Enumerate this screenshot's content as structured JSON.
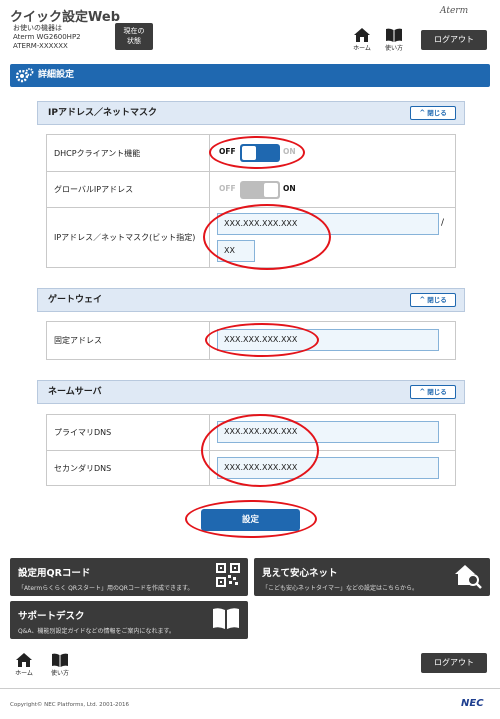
{
  "header": {
    "title": "クイック設定Web",
    "device_line1": "お使いの機器は",
    "device_line2": "Aterm WG2600HP2",
    "device_line3": "ATERM-XXXXXX",
    "status_line1": "現在の",
    "status_line2": "状態",
    "brand": "Aterm",
    "home_label": "ホーム",
    "manual_label": "使い方",
    "logout_label": "ログアウト"
  },
  "section": {
    "title": "詳細設定"
  },
  "panels": {
    "ip": {
      "title": "IPアドレス／ネットマスク",
      "close_label": "閉じる",
      "rows": {
        "dhcp": {
          "label": "DHCPクライアント機能",
          "off": "OFF",
          "on": "ON"
        },
        "global_ip": {
          "label": "グローバルIPアドレス",
          "off": "OFF",
          "on": "ON"
        },
        "ip_mask": {
          "label": "IPアドレス／ネットマスク(ビット指定)",
          "ip_value": "XXX.XXX.XXX.XXX",
          "slash": "/",
          "mask_value": "XX"
        }
      }
    },
    "gateway": {
      "title": "ゲートウェイ",
      "close_label": "閉じる",
      "fixed_label": "固定アドレス",
      "fixed_value": "XXX.XXX.XXX.XXX"
    },
    "dns": {
      "title": "ネームサーバ",
      "close_label": "閉じる",
      "primary_label": "プライマリDNS",
      "primary_value": "XXX.XXX.XXX.XXX",
      "secondary_label": "セカンダリDNS",
      "secondary_value": "XXX.XXX.XXX.XXX"
    }
  },
  "submit_label": "設定",
  "tiles": {
    "qr": {
      "title": "設定用QRコード",
      "desc": "「Atermらくらく QRスタート」用のQRコードを作成できます。"
    },
    "safety": {
      "title": "見えて安心ネット",
      "desc": "「こども安心ネットタイマー」などの設定はこちらから。"
    },
    "support": {
      "title": "サポートデスク",
      "desc": "Q&A、機能別設定ガイドなどの情報をご案内になれます。"
    }
  },
  "footer": {
    "home_label": "ホーム",
    "manual_label": "使い方",
    "logout_label": "ログアウト",
    "copyright": "Copyright© NEC Platforms, Ltd. 2001-2016",
    "nec": "NEC"
  },
  "colors": {
    "accent": "#1f68b0",
    "dark_button": "#3c3c3c",
    "highlight_ring": "#e3141a"
  }
}
